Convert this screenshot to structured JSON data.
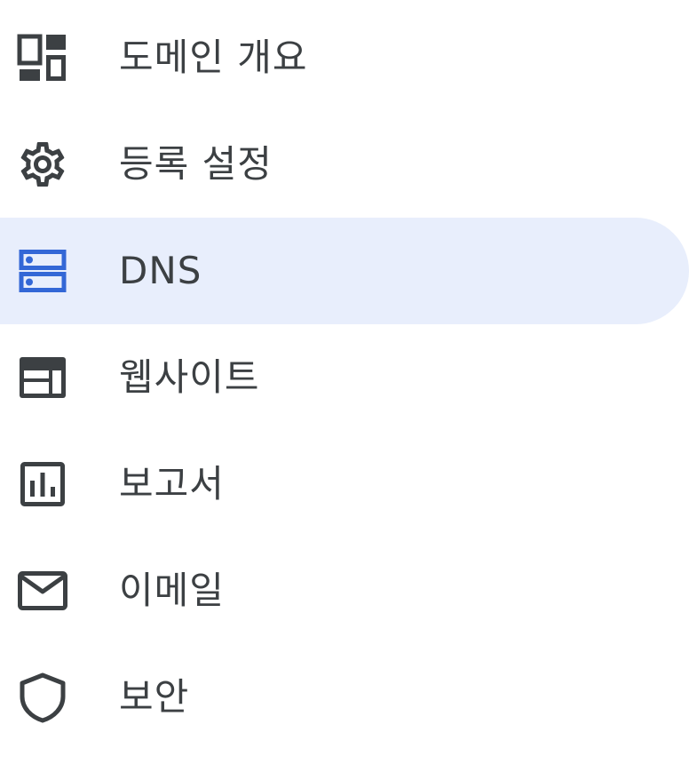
{
  "colors": {
    "icon": "#3c4043",
    "text": "#3c4043",
    "accent": "#3367d6",
    "active_background": "#e8eefc",
    "background": "#ffffff"
  },
  "sidebar": {
    "active_item": "dns",
    "items": [
      {
        "id": "overview",
        "label": "도메인 개요",
        "icon": "dashboard-icon"
      },
      {
        "id": "registration",
        "label": "등록 설정",
        "icon": "gear-icon"
      },
      {
        "id": "dns",
        "label": "DNS",
        "icon": "dns-icon"
      },
      {
        "id": "website",
        "label": "웹사이트",
        "icon": "web-layout-icon"
      },
      {
        "id": "reports",
        "label": "보고서",
        "icon": "bar-chart-icon"
      },
      {
        "id": "email",
        "label": "이메일",
        "icon": "mail-icon"
      },
      {
        "id": "security",
        "label": "보안",
        "icon": "shield-icon"
      }
    ]
  }
}
